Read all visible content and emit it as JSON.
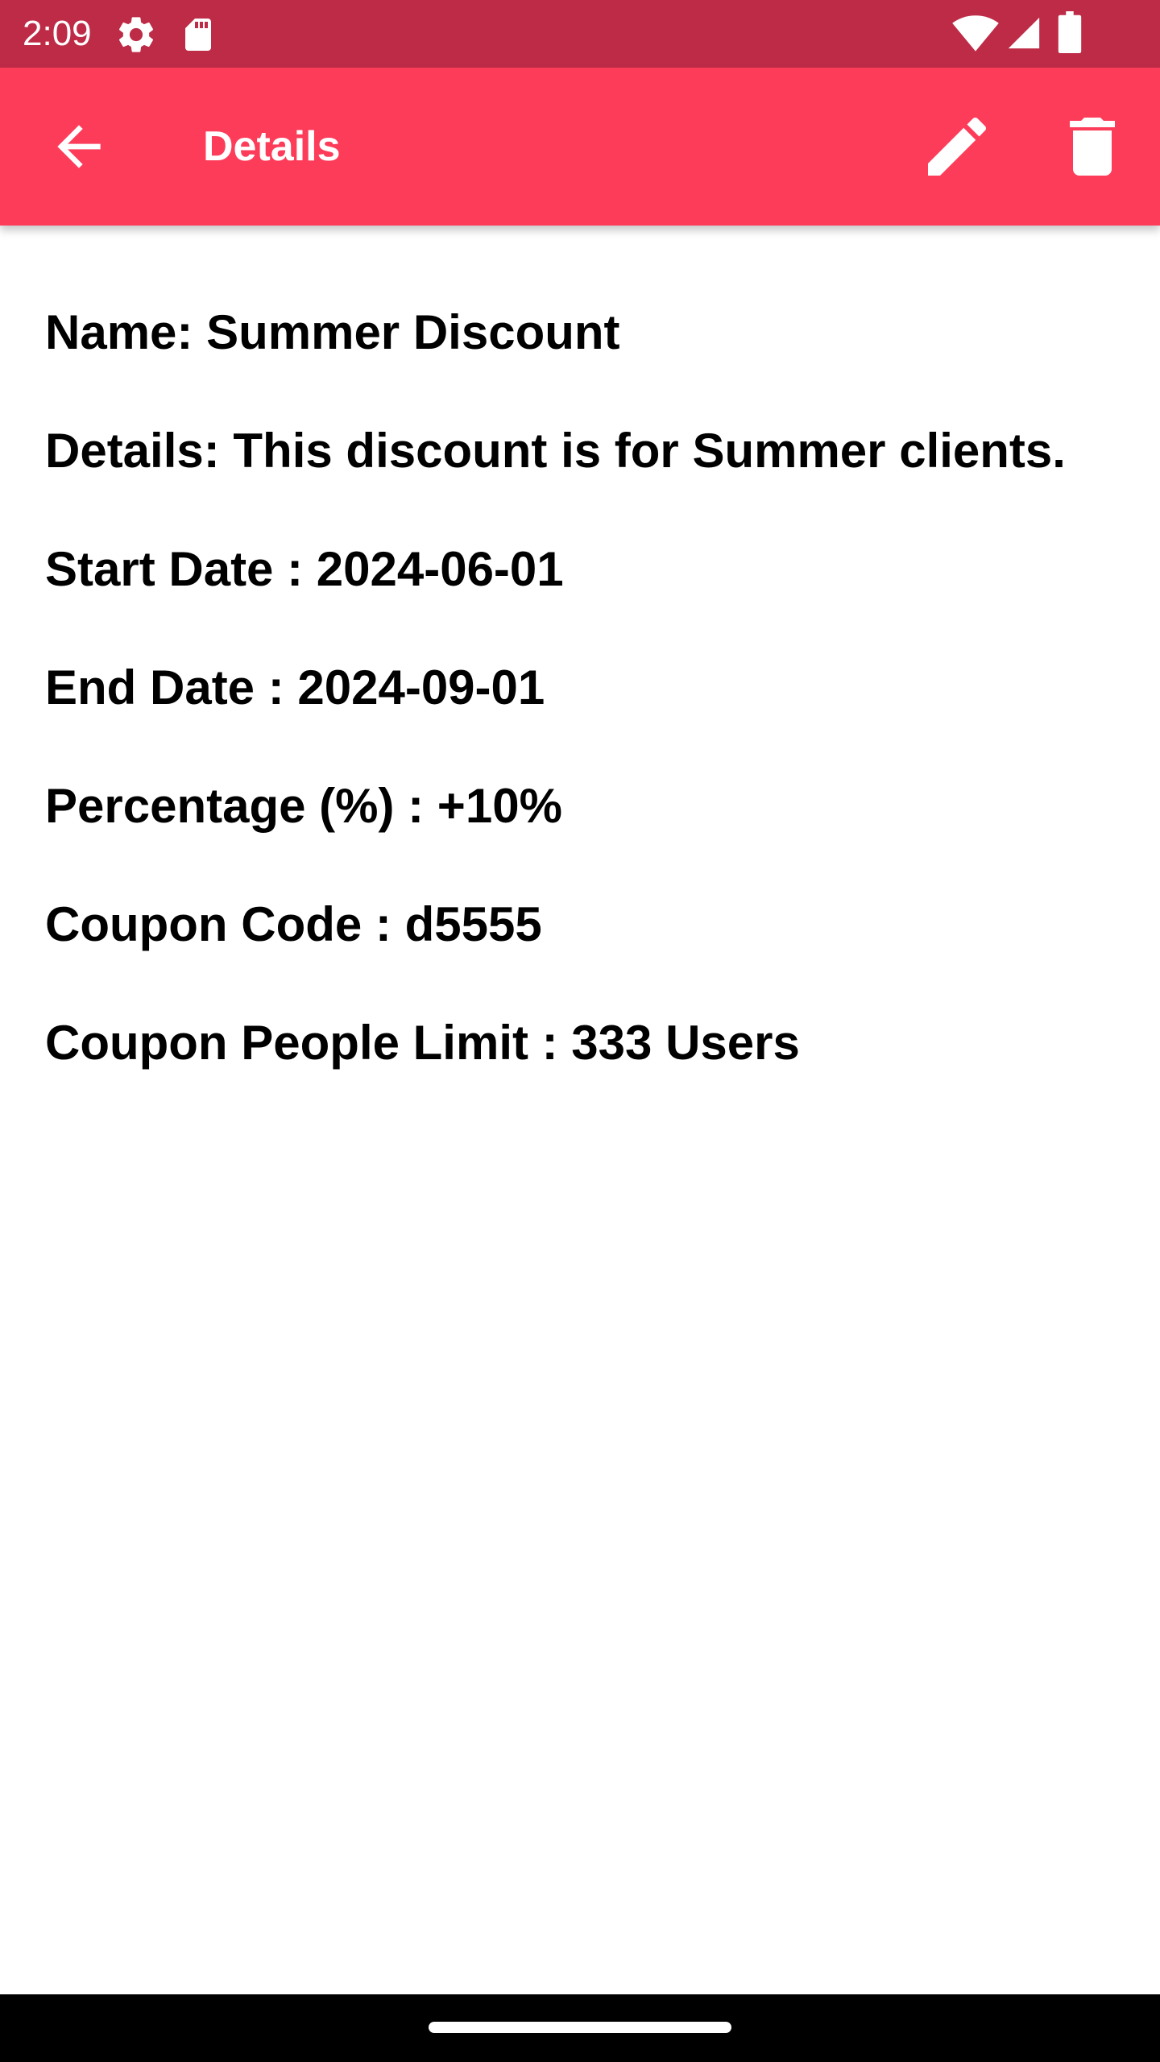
{
  "status_bar": {
    "time": "2:09",
    "icons": [
      "settings-gear-icon",
      "sd-card-icon",
      "wifi-icon",
      "cellular-signal-icon",
      "battery-icon"
    ]
  },
  "app_bar": {
    "title": "Details",
    "color": "#fd3c5a",
    "status_color": "#be2b47",
    "back_icon": "arrow-back-icon",
    "edit_icon": "pencil-icon",
    "delete_icon": "trash-icon"
  },
  "details": {
    "name": "Name: Summer Discount",
    "description": "Details: This discount is for Summer clients.",
    "start_date": "Start Date : 2024-06-01",
    "end_date": "End Date : 2024-09-01",
    "percentage": "Percentage (%) : +10%",
    "coupon_code": "Coupon Code : d5555",
    "people_limit": "Coupon People Limit : 333 Users"
  }
}
